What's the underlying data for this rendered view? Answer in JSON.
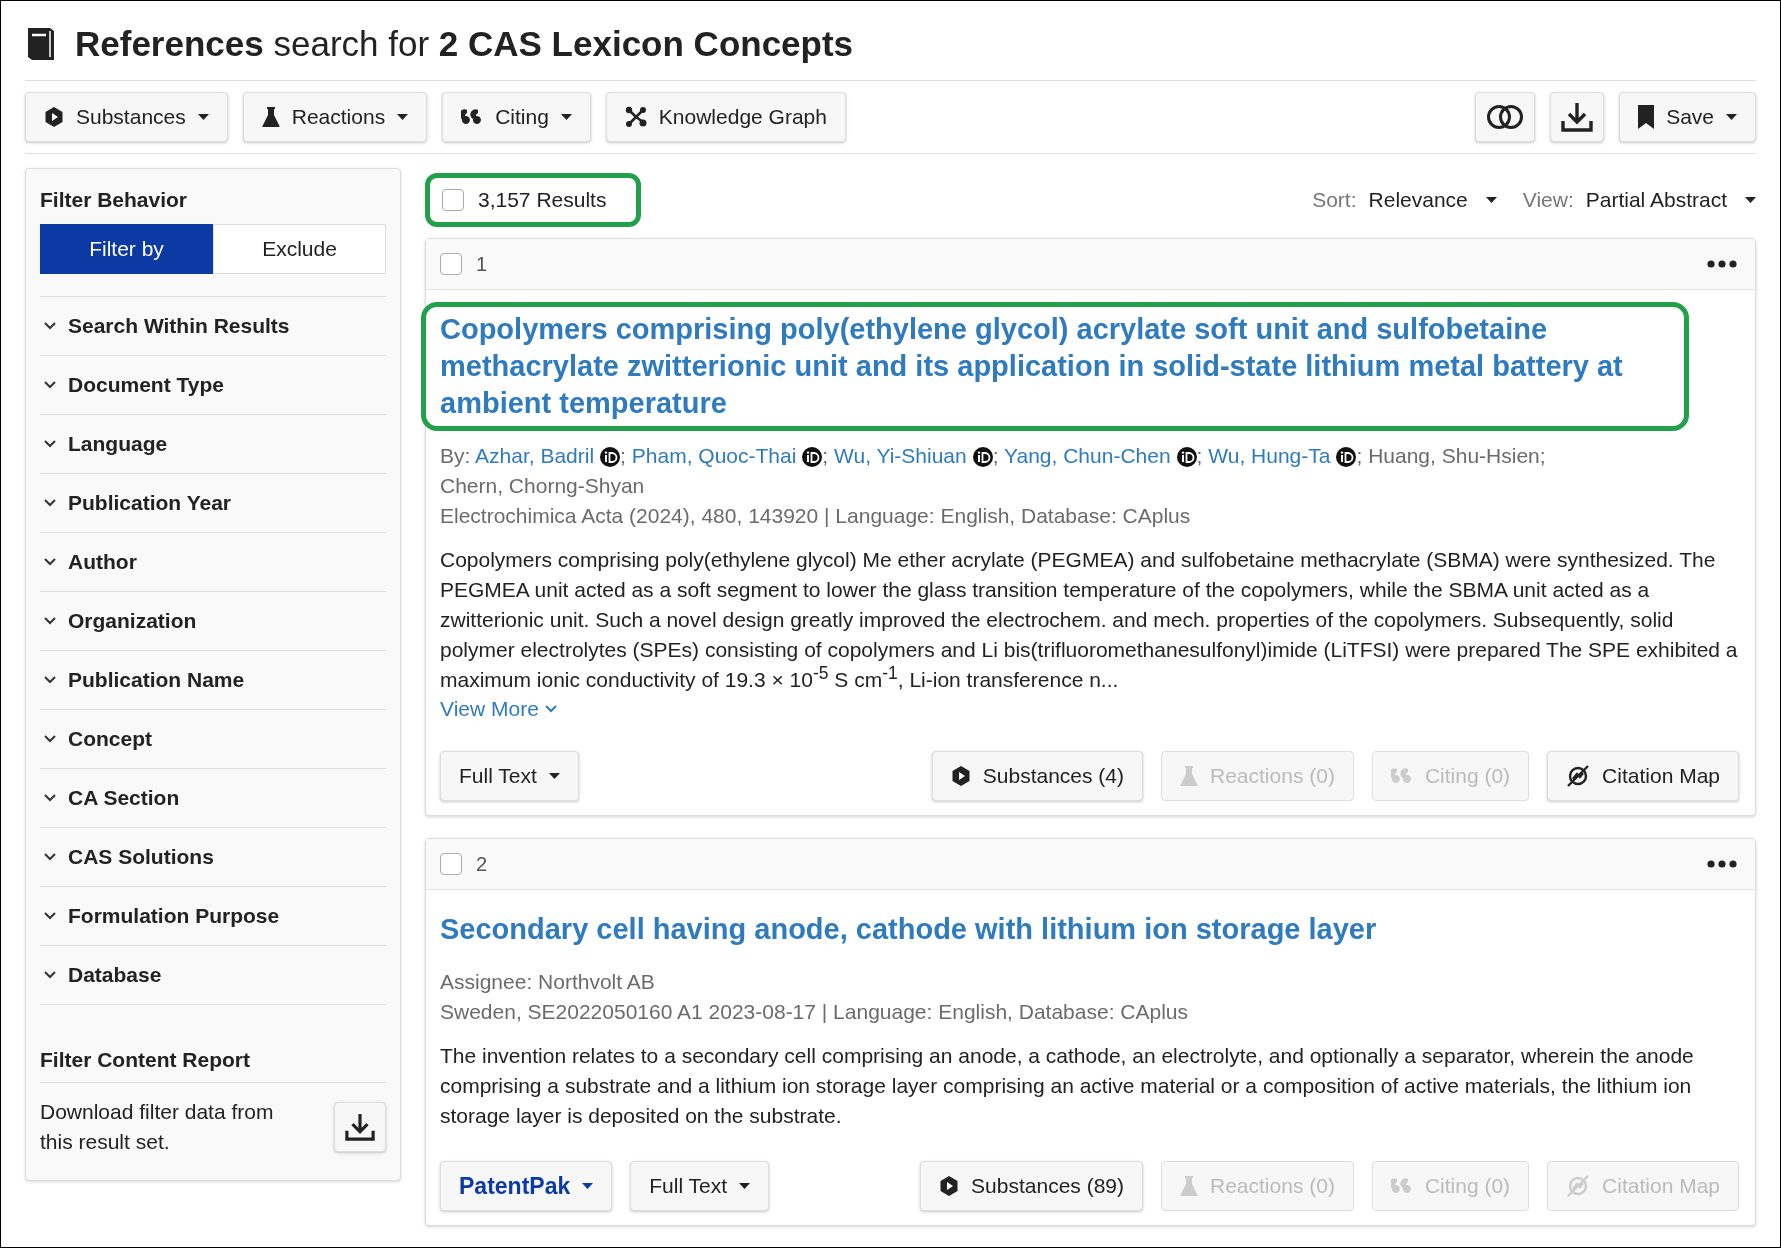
{
  "header": {
    "title": "**References** search for **2 CAS Lexicon Concepts**"
  },
  "toolbar": {
    "left": [
      {
        "kind": "substances",
        "label": "Substances",
        "dropdown": true
      },
      {
        "kind": "reactions",
        "label": "Reactions",
        "dropdown": true
      },
      {
        "kind": "citing",
        "label": "Citing",
        "dropdown": true
      },
      {
        "kind": "graph",
        "label": "Knowledge Graph",
        "dropdown": false
      }
    ],
    "right": [
      {
        "kind": "compare"
      },
      {
        "kind": "download"
      },
      {
        "kind": "save",
        "label": "Save",
        "dropdown": true
      }
    ]
  },
  "sidebar": {
    "filter_behavior": {
      "title": "Filter Behavior",
      "options": [
        {
          "label": "Filter by",
          "selected": true
        },
        {
          "label": "Exclude",
          "selected": false
        }
      ]
    },
    "filters": [
      {
        "label": "Search Within Results",
        "expanded": false
      },
      {
        "label": "Document Type",
        "expanded": false
      },
      {
        "label": "Language",
        "expanded": false
      },
      {
        "label": "Publication Year",
        "expanded": false
      },
      {
        "label": "Author",
        "expanded": false
      },
      {
        "label": "Organization",
        "expanded": false
      },
      {
        "label": "Publication Name",
        "expanded": false
      },
      {
        "label": "Concept",
        "expanded": false
      },
      {
        "label": "CA Section",
        "expanded": false
      },
      {
        "label": "CAS Solutions",
        "expanded": false
      },
      {
        "label": "Formulation Purpose",
        "expanded": false
      },
      {
        "label": "Database",
        "expanded": false
      }
    ],
    "report": {
      "title": "Filter Content Report",
      "text": "Download filter data from this result set."
    }
  },
  "results_bar": {
    "select_all": {
      "label": "3,157 Results",
      "checked": false,
      "highlighted": true
    },
    "sort": {
      "label": "Sort:",
      "value": "Relevance"
    },
    "view": {
      "label": "View:",
      "value": "Partial Abstract"
    }
  },
  "results": [
    {
      "number": "1",
      "checked": false,
      "title": "Copolymers comprising poly(ethylene glycol) acrylate soft unit and sulfobetaine methacrylate zwitterionic unit and its application in solid-state lithium metal battery at ambient temperature",
      "highlighted": true,
      "byline_label": "By:",
      "authors": [
        {
          "name": "Azhar, Badril",
          "linked": true,
          "orcid": true,
          "sep": ";"
        },
        {
          "name": "Pham, Quoc-Thai",
          "linked": true,
          "orcid": true,
          "sep": ";"
        },
        {
          "name": "Wu, Yi-Shiuan",
          "linked": true,
          "orcid": true,
          "sep": ";"
        },
        {
          "name": "Yang, Chun-Chen",
          "linked": true,
          "orcid": true,
          "sep": ";"
        },
        {
          "name": "Wu, Hung-Ta",
          "linked": true,
          "orcid": true,
          "sep": ";"
        },
        {
          "name": "Huang, Shu-Hsien",
          "linked": false,
          "orcid": false,
          "sep": ";"
        },
        {
          "name": "Chern, Chorng-Shyan",
          "linked": false,
          "orcid": false
        }
      ],
      "source": "Electrochimica Acta (2024), 480, 143920 | Language: English, Database: CAplus",
      "abstract": "Copolymers comprising poly(ethylene glycol) Me ether acrylate (PEGMEA) and sulfobetaine methacrylate (SBMA) were synthesized. The PEGMEA unit acted as a soft segment to lower the glass transition temperature of the copolymers, while the SBMA unit acted as a zwitterionic unit. Such a novel design greatly improved the electrochem. and mech. properties of the copolymers. Subsequently, solid polymer electrolytes (SPEs) consisting of copolymers and Li bis(trifluoromethanesulfonyl)imide (LiTFSI) were prepared The SPE exhibited a maximum ionic conductivity of 19.3 × 10$^{-5}$ S cm$^{-1}$, Li-ion transference n...",
      "view_more": "View More",
      "left_actions": [
        {
          "kind": "fulltext",
          "label": "Full Text",
          "disabled": false
        }
      ],
      "right_actions": [
        {
          "kind": "substances",
          "label": "Substances (4)",
          "disabled": false
        },
        {
          "kind": "reactions",
          "label": "Reactions (0)",
          "disabled": true
        },
        {
          "kind": "citing",
          "label": "Citing (0)",
          "disabled": true
        },
        {
          "kind": "citation_map",
          "label": "Citation Map",
          "disabled": false
        }
      ]
    },
    {
      "number": "2",
      "checked": false,
      "title": "Secondary cell having anode, cathode with lithium ion storage layer",
      "highlighted": false,
      "assignee": "Assignee: Northvolt AB",
      "source": "Sweden, SE2022050160 A1 2023-08-17 | Language: English, Database: CAplus",
      "abstract": "The invention relates to a secondary cell comprising an anode, a cathode, an electrolyte, and optionally a separator, wherein the anode comprising a substrate and a lithium ion storage layer comprising an active material or a composition of active materials, the lithium ion storage layer is deposited on the substrate.",
      "left_actions": [
        {
          "kind": "patentpak",
          "label": "PatentPak",
          "disabled": false
        },
        {
          "kind": "fulltext",
          "label": "Full Text",
          "disabled": false
        }
      ],
      "right_actions": [
        {
          "kind": "substances",
          "label": "Substances (89)",
          "disabled": false
        },
        {
          "kind": "reactions",
          "label": "Reactions (0)",
          "disabled": true
        },
        {
          "kind": "citing",
          "label": "Citing (0)",
          "disabled": true
        },
        {
          "kind": "citation_map",
          "label": "Citation Map",
          "disabled": true
        }
      ]
    }
  ]
}
